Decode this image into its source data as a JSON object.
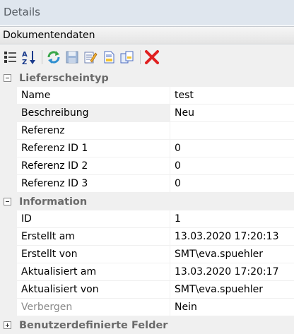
{
  "panel": {
    "title": "Details"
  },
  "selector": {
    "value": "Dokumentendaten"
  },
  "toolbar": {
    "buttons": [
      {
        "icon": "categorized-view-icon"
      },
      {
        "icon": "alphabetical-sort-icon",
        "label": "A↓Z"
      },
      {
        "icon": "refresh-icon"
      },
      {
        "icon": "save-icon"
      },
      {
        "icon": "edit-icon"
      },
      {
        "icon": "document-icon"
      },
      {
        "icon": "copy-icon"
      },
      {
        "icon": "delete-icon"
      }
    ]
  },
  "categories": [
    {
      "label": "Lieferscheintyp",
      "rows": [
        {
          "name": "Name",
          "value": "test"
        },
        {
          "name": "Beschreibung",
          "value": "Neu"
        },
        {
          "name": "Referenz",
          "value": ""
        },
        {
          "name": "Referenz ID 1",
          "value": "0"
        },
        {
          "name": "Referenz ID 2",
          "value": "0"
        },
        {
          "name": "Referenz ID 3",
          "value": "0"
        }
      ]
    },
    {
      "label": "Information",
      "rows": [
        {
          "name": "ID",
          "value": "1"
        },
        {
          "name": "Erstellt am",
          "value": "13.03.2020 17:20:13"
        },
        {
          "name": "Erstellt von",
          "value": "SMT\\eva.spuehler"
        },
        {
          "name": "Aktualisiert am",
          "value": "13.03.2020 17:20:17"
        },
        {
          "name": "Aktualisiert von",
          "value": "SMT\\eva.spuehler"
        },
        {
          "name": "Verbergen",
          "value": "Nein"
        }
      ]
    },
    {
      "label": "Benutzerdefinierte Felder",
      "rows": []
    }
  ],
  "colors": {
    "header_bg": "#dfe6ee",
    "gutter": "#f0f0f0",
    "delete_red": "#e02020",
    "refresh_green": "#3aa64a"
  }
}
